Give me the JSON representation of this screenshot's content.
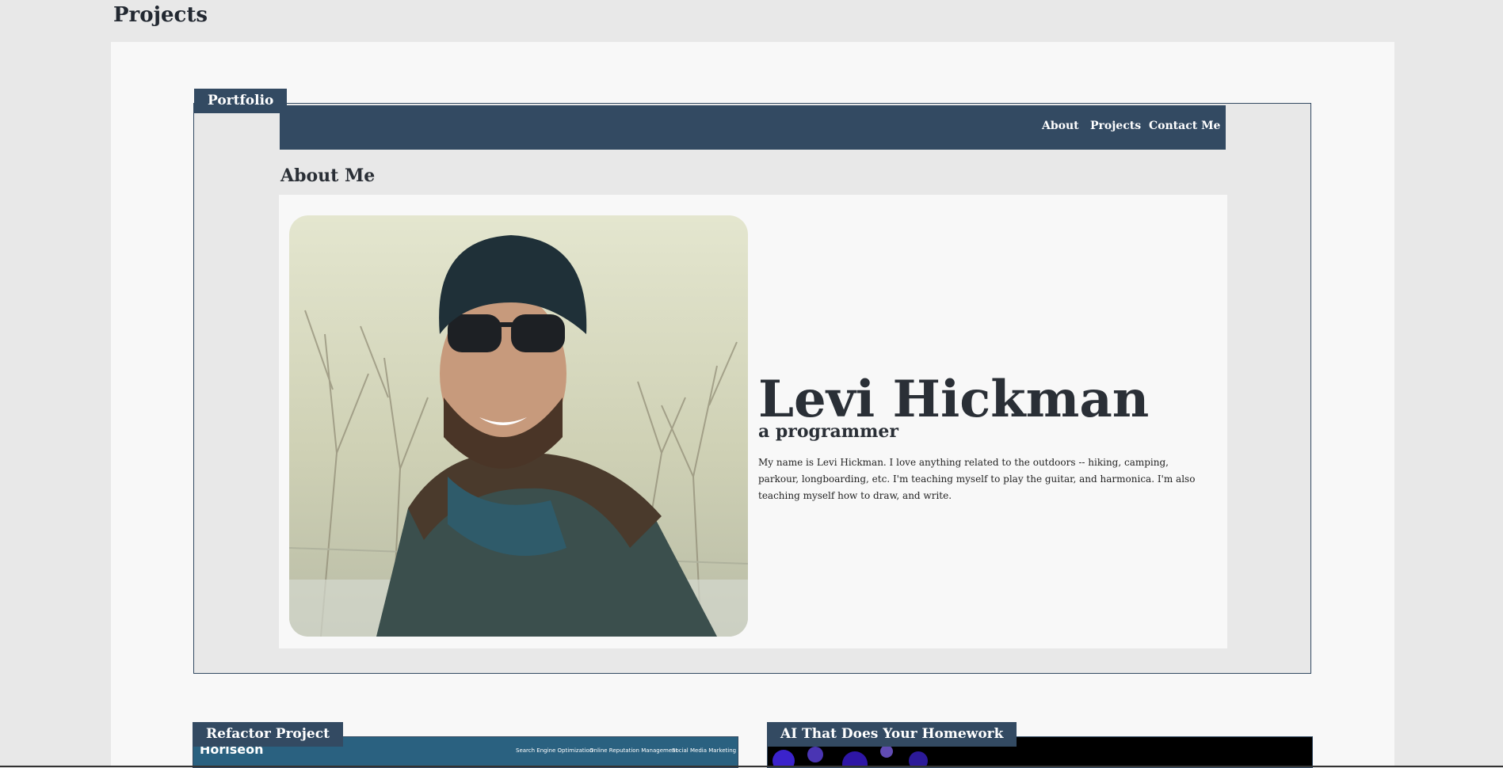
{
  "page": {
    "title": "Projects"
  },
  "portfolio": {
    "label": "Portfolio",
    "nav": [
      "About",
      "Projects",
      "Contact Me"
    ],
    "about_heading": "About Me",
    "name": "Levi Hickman",
    "role": "a programmer",
    "bio": "My name is Levi Hickman. I love anything related to the outdoors -- hiking, camping, parkour, longboarding, etc. I'm teaching myself to play the guitar, and harmonica. I'm also teaching myself how to draw, and write."
  },
  "projects": [
    {
      "label": "Refactor Project",
      "preview": {
        "logo": "Horiseon",
        "nav": [
          "Search Engine Optimization",
          "Online Reputation Management",
          "Social Media Marketing"
        ]
      }
    },
    {
      "label": "AI That Does Your Homework"
    }
  ],
  "colors": {
    "accent": "#334a62",
    "background": "#e8e8e8",
    "panel": "#f8f8f8"
  }
}
